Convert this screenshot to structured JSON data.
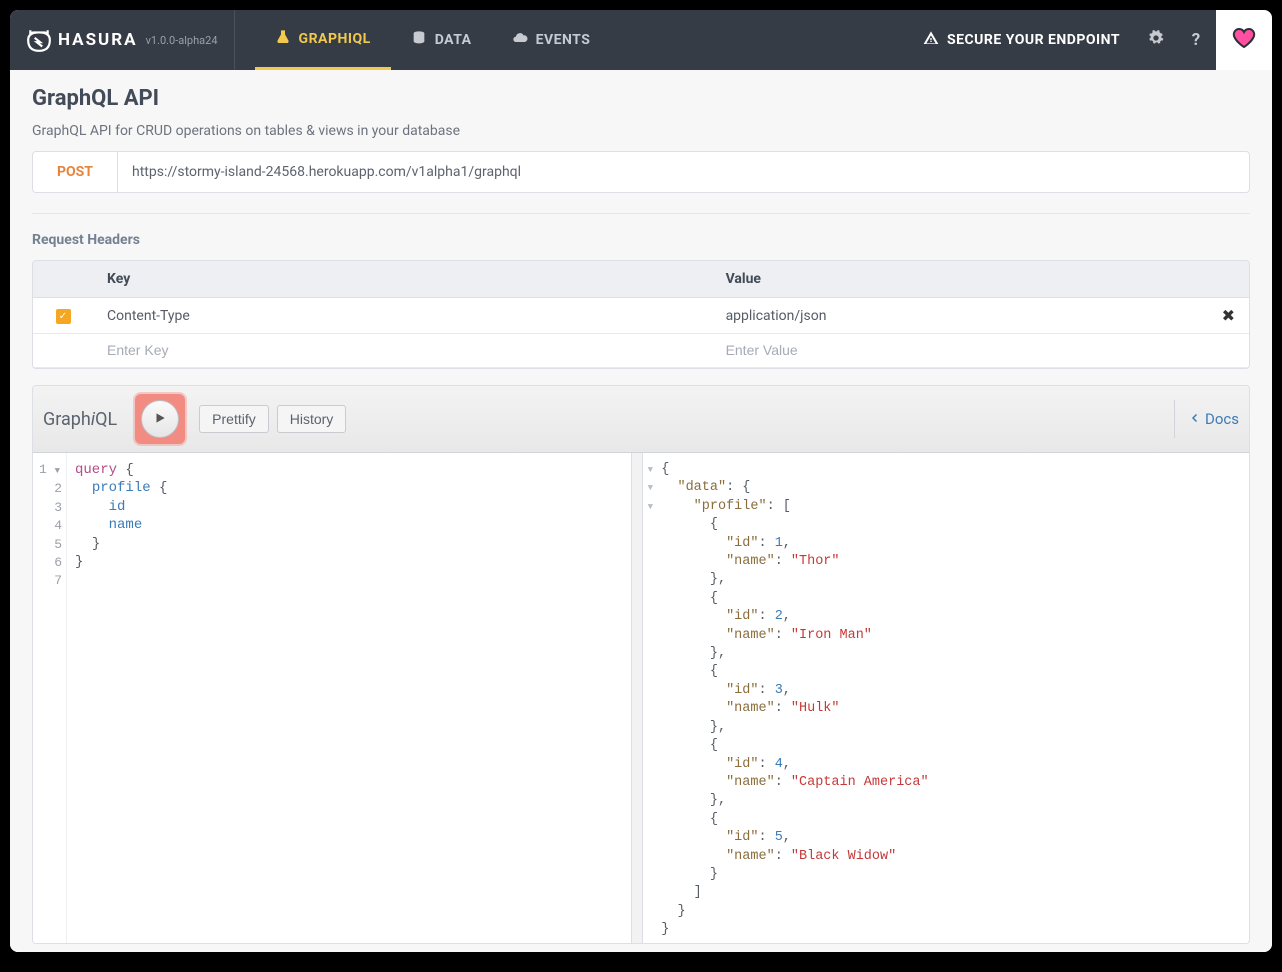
{
  "brand": {
    "name": "HASURA",
    "version": "v1.0.0-alpha24"
  },
  "nav": {
    "graphiql": "GRAPHIQL",
    "data": "DATA",
    "events": "EVENTS",
    "secure": "SECURE YOUR ENDPOINT"
  },
  "page": {
    "title": "GraphQL API",
    "description": "GraphQL API for CRUD operations on tables & views in your database",
    "method": "POST",
    "endpoint": "https://stormy-island-24568.herokuapp.com/v1alpha1/graphql"
  },
  "headers": {
    "section_label": "Request Headers",
    "key_col": "Key",
    "value_col": "Value",
    "rows": [
      {
        "enabled": true,
        "key": "Content-Type",
        "value": "application/json"
      }
    ],
    "key_placeholder": "Enter Key",
    "value_placeholder": "Enter Value"
  },
  "graphiql": {
    "logo_pre": "Graph",
    "logo_i": "i",
    "logo_post": "QL",
    "prettify": "Prettify",
    "history": "History",
    "docs": "Docs",
    "line_numbers": [
      "1",
      "2",
      "3",
      "4",
      "5",
      "6",
      "7"
    ],
    "query": {
      "l1_kw": "query",
      "l2_def": "profile",
      "l3_attr": "id",
      "l4_attr": "name"
    },
    "result": {
      "data_key": "\"data\"",
      "profile_key": "\"profile\"",
      "id_key": "\"id\"",
      "name_key": "\"name\"",
      "records": [
        {
          "id": 1,
          "name": "\"Thor\""
        },
        {
          "id": 2,
          "name": "\"Iron Man\""
        },
        {
          "id": 3,
          "name": "\"Hulk\""
        },
        {
          "id": 4,
          "name": "\"Captain America\""
        },
        {
          "id": 5,
          "name": "\"Black Widow\""
        }
      ]
    }
  }
}
